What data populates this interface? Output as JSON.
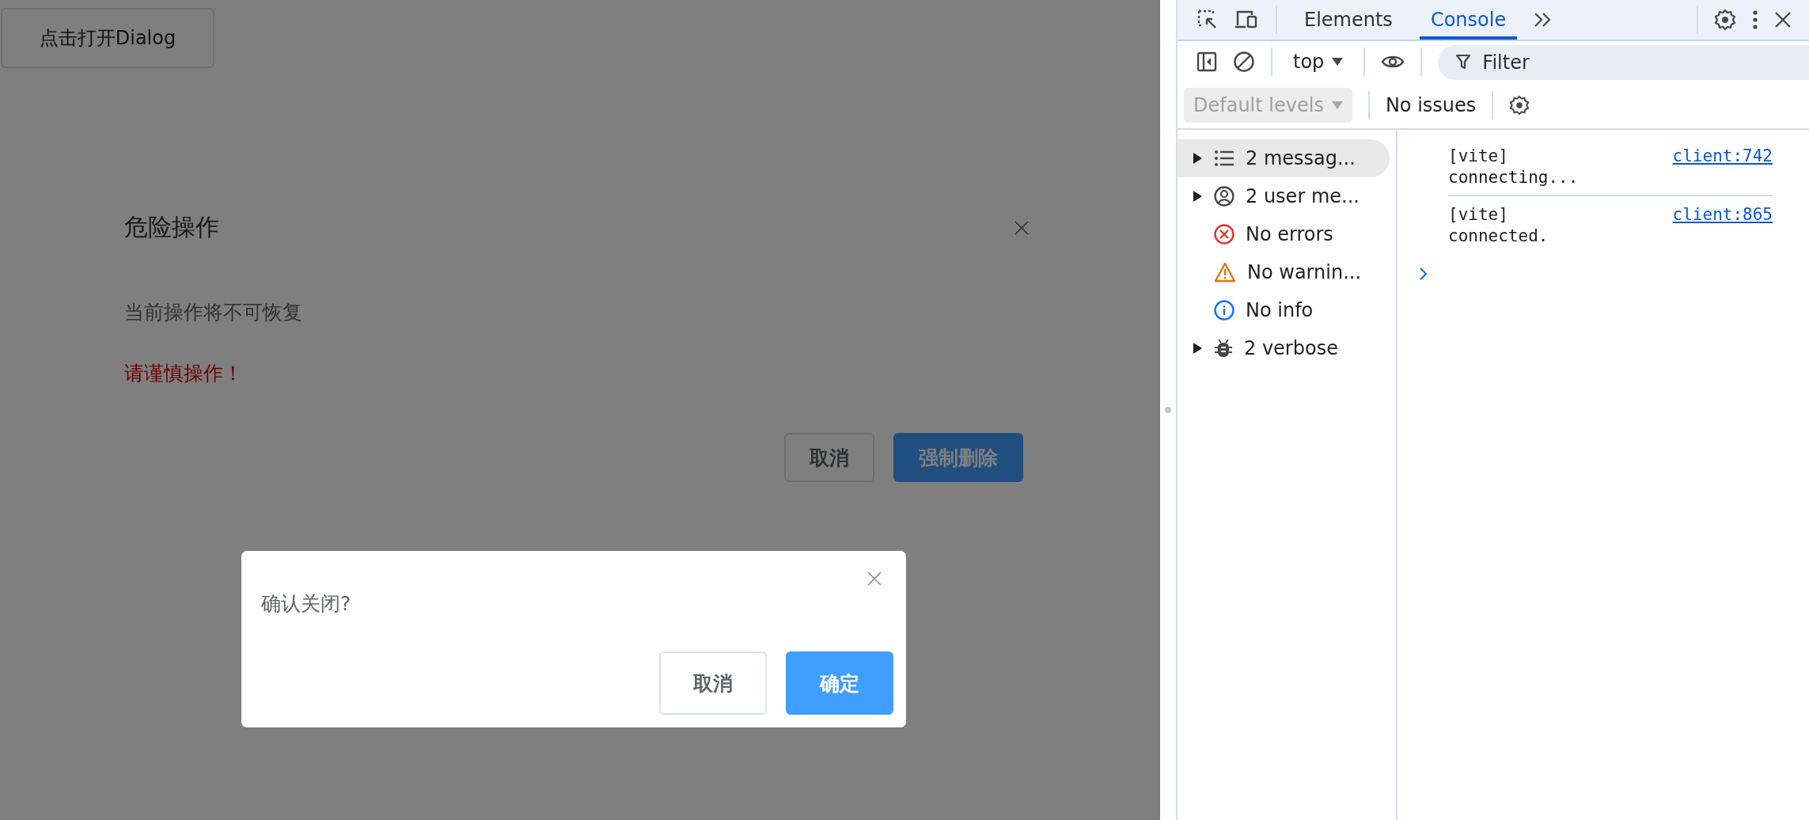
{
  "page": {
    "open_button": "点击打开Dialog",
    "mask": true
  },
  "dialogs": [
    {
      "title": "危险操作",
      "paragraphs": [
        {
          "text": "当前操作将不可恢复",
          "kind": "normal"
        },
        {
          "text": "请谨慎操作！",
          "kind": "warning"
        }
      ],
      "buttons": [
        {
          "label": "取消",
          "kind": "default"
        },
        {
          "label": "强制删除",
          "kind": "primary"
        }
      ]
    },
    {
      "message": "确认关闭?",
      "buttons": [
        {
          "label": "取消",
          "kind": "default"
        },
        {
          "label": "确定",
          "kind": "primary"
        }
      ]
    }
  ],
  "devtools": {
    "tabs": [
      {
        "label": "Elements",
        "selected": false
      },
      {
        "label": "Console",
        "selected": true
      }
    ],
    "context": "top",
    "filter": {
      "placeholder": "Filter"
    },
    "levels": {
      "label": "Default levels",
      "disabled": true
    },
    "issues": "No issues",
    "sidebar": [
      {
        "label": "2 messag...",
        "kind": "list",
        "expandable": true,
        "selected": true
      },
      {
        "label": "2 user me...",
        "kind": "user",
        "expandable": true,
        "selected": false
      },
      {
        "label": "No errors",
        "kind": "error",
        "expandable": false,
        "selected": false
      },
      {
        "label": "No warnin...",
        "kind": "warning",
        "expandable": false,
        "selected": false
      },
      {
        "label": "No info",
        "kind": "info",
        "expandable": false,
        "selected": false
      },
      {
        "label": "2 verbose",
        "kind": "verbose",
        "expandable": true,
        "selected": false
      }
    ],
    "messages": [
      {
        "text": "[vite] connecting...",
        "source": "client:742"
      },
      {
        "text": "[vite] connected.",
        "source": "client:865"
      }
    ]
  }
}
